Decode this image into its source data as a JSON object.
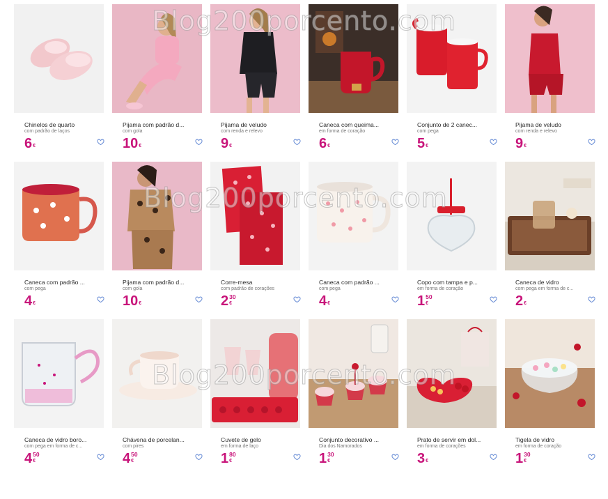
{
  "watermark": "Blog200porcento.com",
  "brand_color": "#c8147a",
  "heart_color": "#6b8fd6",
  "products": [
    {
      "name": "Chinelos de quarto",
      "sub": "com padrão de laços",
      "price_int": "6",
      "price_dec": "",
      "currency": "€"
    },
    {
      "name": "Pijama com padrão d...",
      "sub": "com gola",
      "price_int": "10",
      "price_dec": "",
      "currency": "€"
    },
    {
      "name": "Pijama de veludo",
      "sub": "com renda e relevo",
      "price_int": "9",
      "price_dec": "",
      "currency": "€"
    },
    {
      "name": "Caneca com queima...",
      "sub": "em forma de coração",
      "price_int": "6",
      "price_dec": "",
      "currency": "€"
    },
    {
      "name": "Conjunto de 2 canec...",
      "sub": "com pega",
      "price_int": "5",
      "price_dec": "",
      "currency": "€"
    },
    {
      "name": "Pijama de veludo",
      "sub": "com renda e relevo",
      "price_int": "9",
      "price_dec": "",
      "currency": "€"
    },
    {
      "name": "Caneca com padrão ...",
      "sub": "com pega",
      "price_int": "4",
      "price_dec": "",
      "currency": "€"
    },
    {
      "name": "Pijama com padrão d...",
      "sub": "com gola",
      "price_int": "10",
      "price_dec": "",
      "currency": "€"
    },
    {
      "name": "Corre-mesa",
      "sub": "com padrão de corações",
      "price_int": "2",
      "price_dec": "30",
      "currency": "€"
    },
    {
      "name": "Caneca com padrão ...",
      "sub": "com pega",
      "price_int": "4",
      "price_dec": "",
      "currency": "€"
    },
    {
      "name": "Copo com tampa e p...",
      "sub": "em forma de coração",
      "price_int": "1",
      "price_dec": "50",
      "currency": "€"
    },
    {
      "name": "Caneca de vidro",
      "sub": "com pega em forma de c...",
      "price_int": "2",
      "price_dec": "",
      "currency": "€"
    },
    {
      "name": "Caneca de vidro boro...",
      "sub": "com pega em forma de c...",
      "price_int": "4",
      "price_dec": "50",
      "currency": "€"
    },
    {
      "name": "Chávena de porcelan...",
      "sub": "com pires",
      "price_int": "4",
      "price_dec": "50",
      "currency": "€"
    },
    {
      "name": "Cuvete de gelo",
      "sub": "em forma de laço",
      "price_int": "1",
      "price_dec": "80",
      "currency": "€"
    },
    {
      "name": "Conjunto decorativo ...",
      "sub": "Dia dos Namorados",
      "price_int": "1",
      "price_dec": "30",
      "currency": "€"
    },
    {
      "name": "Prato de servir em dol...",
      "sub": "em forma de corações",
      "price_int": "3",
      "price_dec": "",
      "currency": "€"
    },
    {
      "name": "Tigela de vidro",
      "sub": "em forma de coração",
      "price_int": "1",
      "price_dec": "30",
      "currency": "€"
    }
  ]
}
